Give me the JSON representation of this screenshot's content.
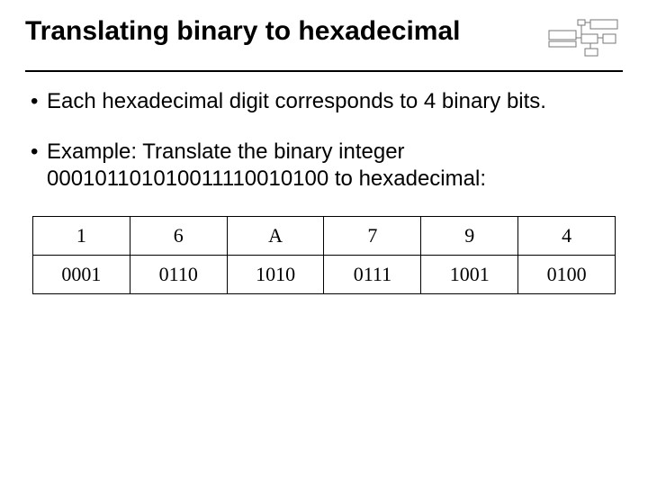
{
  "title": "Translating binary to hexadecimal",
  "bullets": [
    "Each hexadecimal digit corresponds to 4 binary bits.",
    "Example: Translate the binary integer 000101101010011110010100 to hexadecimal:"
  ],
  "chart_data": {
    "type": "table",
    "columns": [
      "c1",
      "c2",
      "c3",
      "c4",
      "c5",
      "c6"
    ],
    "rows": [
      {
        "c1": "1",
        "c2": "6",
        "c3": "A",
        "c4": "7",
        "c5": "9",
        "c6": "4"
      },
      {
        "c1": "0001",
        "c2": "0110",
        "c3": "1010",
        "c4": "0111",
        "c5": "1001",
        "c6": "0100"
      }
    ]
  }
}
